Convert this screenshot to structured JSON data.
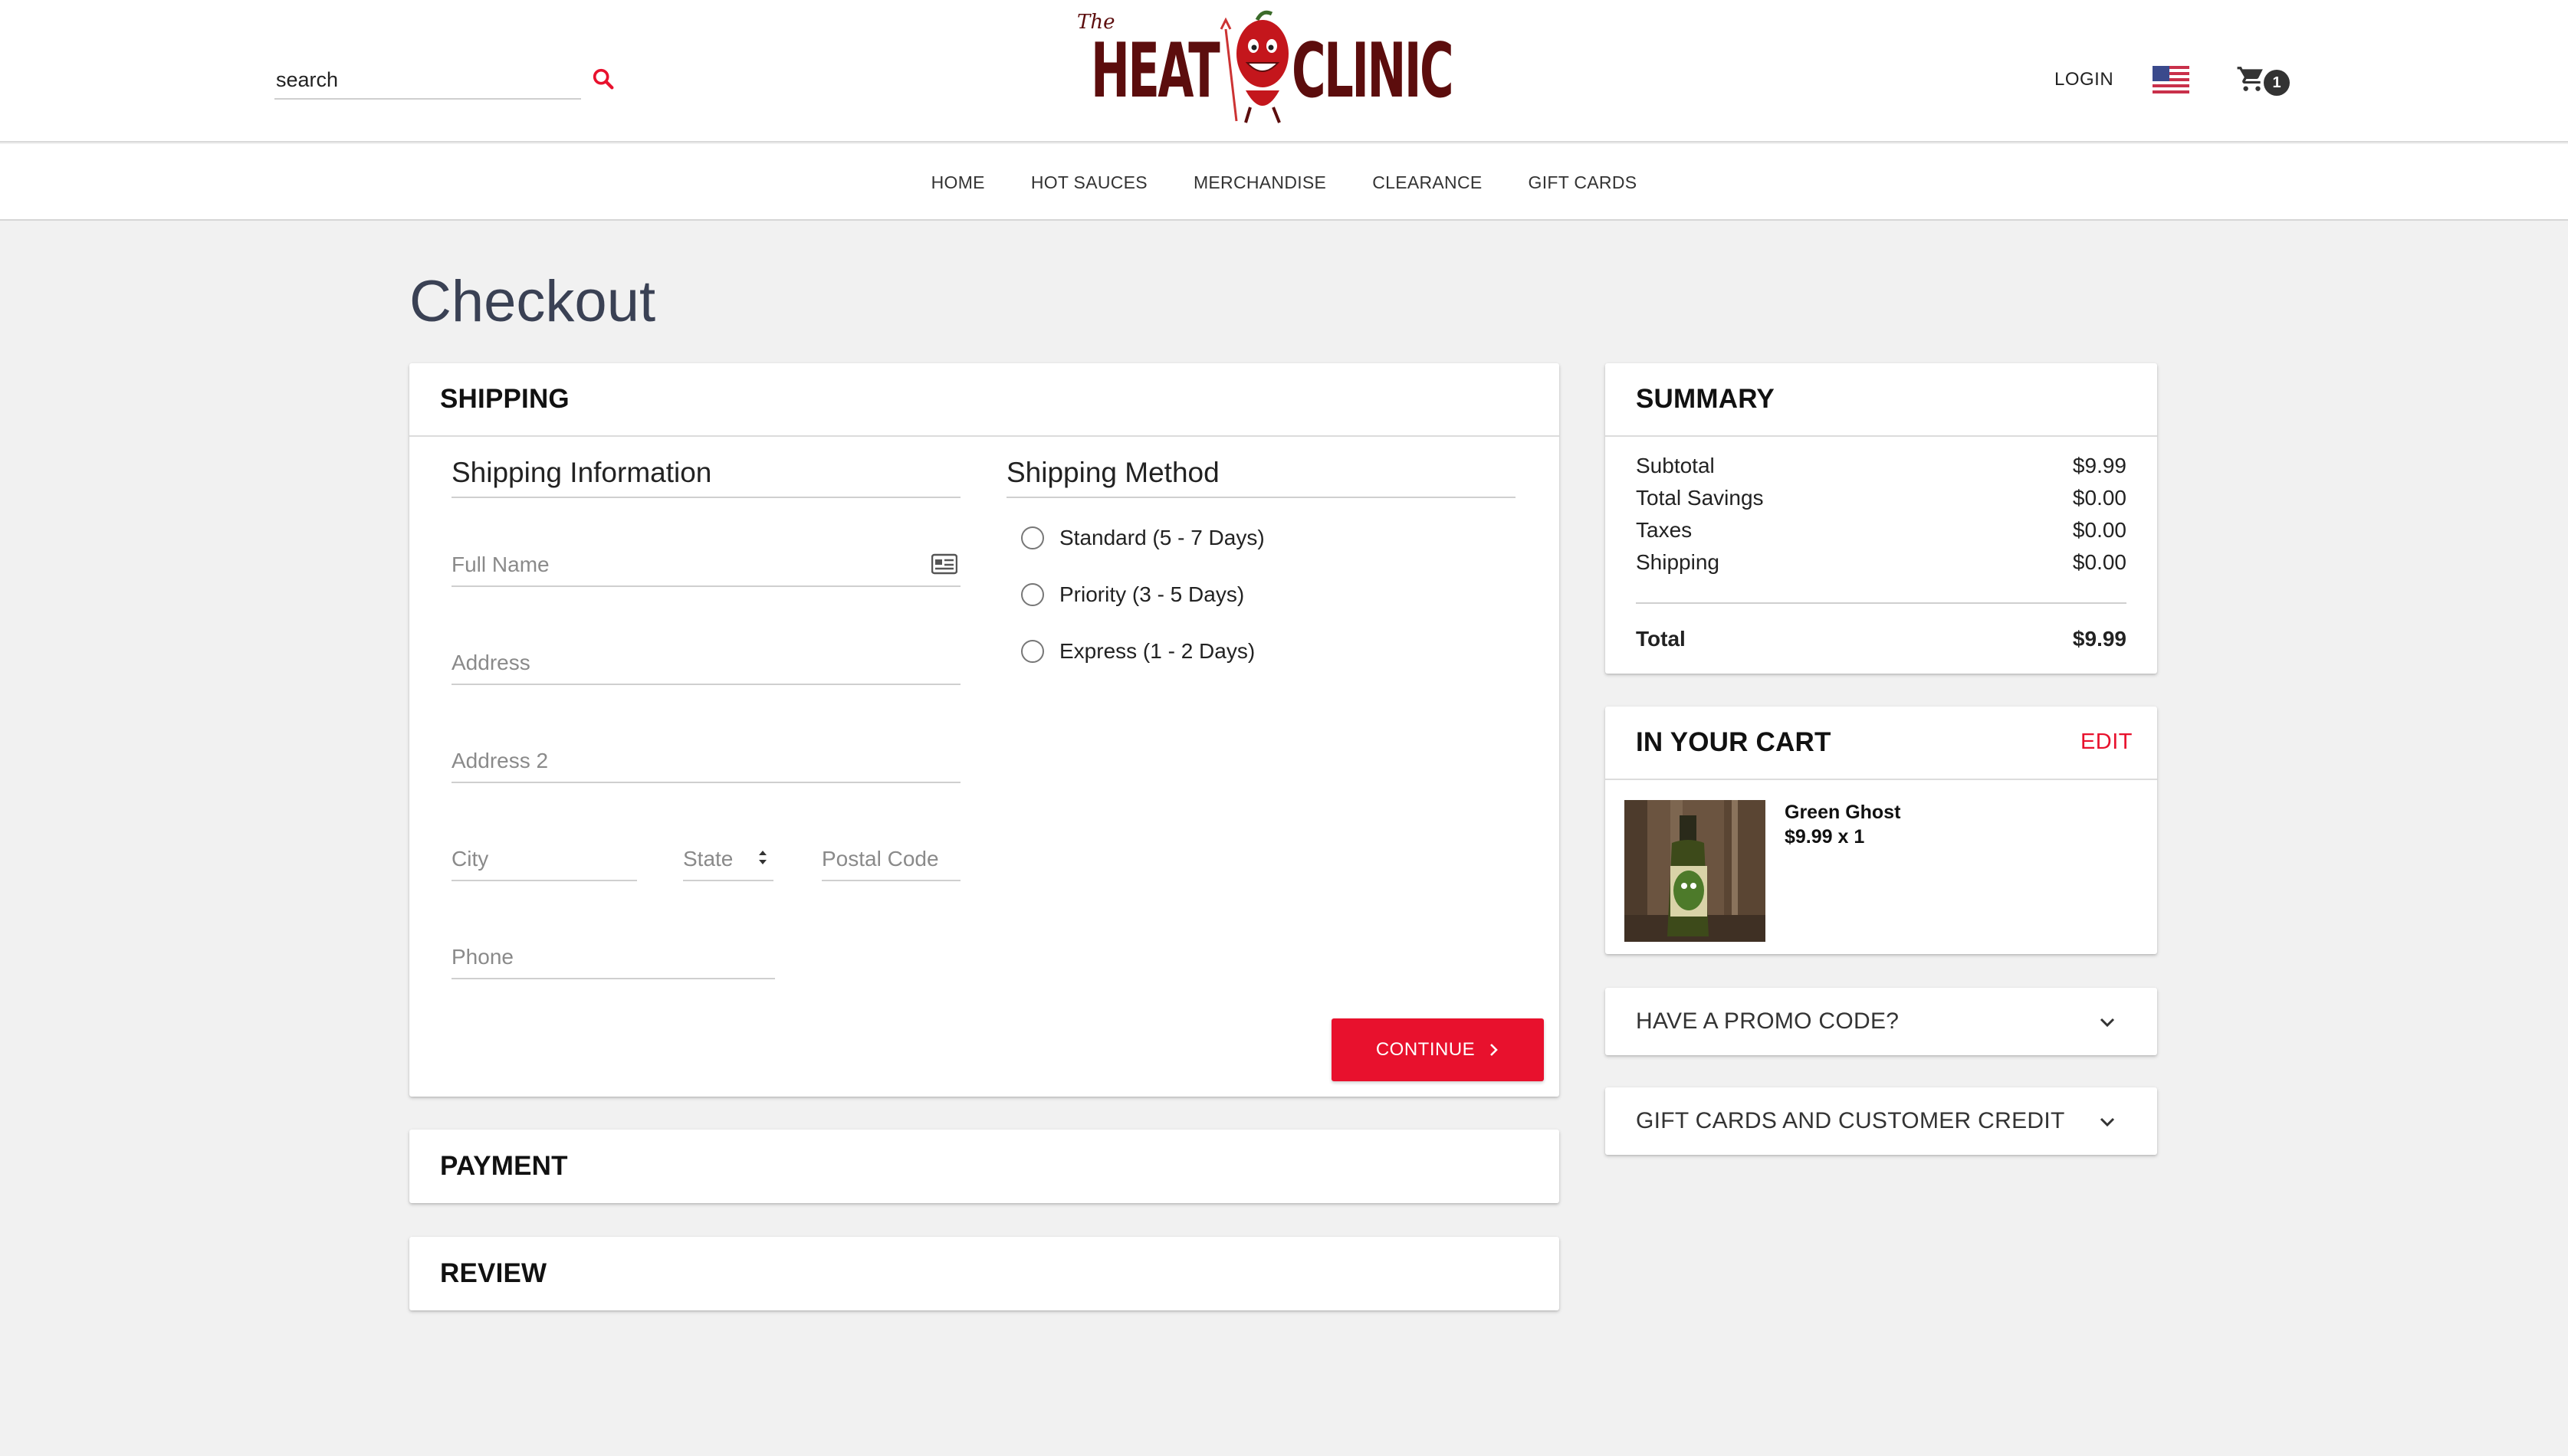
{
  "header": {
    "search": {
      "placeholder": "search",
      "value": ""
    },
    "logo": {
      "the": "The",
      "heat": "HEAT",
      "clinic": "CLINIC"
    },
    "login_label": "LOGIN",
    "cart_count": "1"
  },
  "nav": {
    "items": [
      "HOME",
      "HOT SAUCES",
      "MERCHANDISE",
      "CLEARANCE",
      "GIFT CARDS"
    ]
  },
  "page": {
    "title": "Checkout"
  },
  "shipping": {
    "title": "SHIPPING",
    "info_title": "Shipping Information",
    "fields": {
      "full_name": "Full Name",
      "address": "Address",
      "address2": "Address 2",
      "city": "City",
      "state": "State",
      "postal_code": "Postal Code",
      "phone": "Phone"
    },
    "method_title": "Shipping Method",
    "methods": [
      "Standard (5 - 7 Days)",
      "Priority (3 - 5 Days)",
      "Express (1 - 2 Days)"
    ],
    "continue_label": "CONTINUE"
  },
  "payment": {
    "title": "PAYMENT"
  },
  "review": {
    "title": "REVIEW"
  },
  "summary": {
    "title": "SUMMARY",
    "rows": [
      {
        "label": "Subtotal",
        "value": "$9.99"
      },
      {
        "label": "Total Savings",
        "value": "$0.00"
      },
      {
        "label": "Taxes",
        "value": "$0.00"
      },
      {
        "label": "Shipping",
        "value": "$0.00"
      }
    ],
    "total_label": "Total",
    "total_value": "$9.99"
  },
  "cart": {
    "title": "IN YOUR CART",
    "edit_label": "EDIT",
    "item": {
      "name": "Green Ghost",
      "price_qty": "$9.99 x 1"
    }
  },
  "promo": {
    "title": "HAVE A PROMO CODE?"
  },
  "gift": {
    "title": "GIFT CARDS AND CUSTOMER CREDIT"
  },
  "colors": {
    "accent": "#e8112d",
    "brand": "#5c0d0d",
    "title": "#3a4154"
  }
}
